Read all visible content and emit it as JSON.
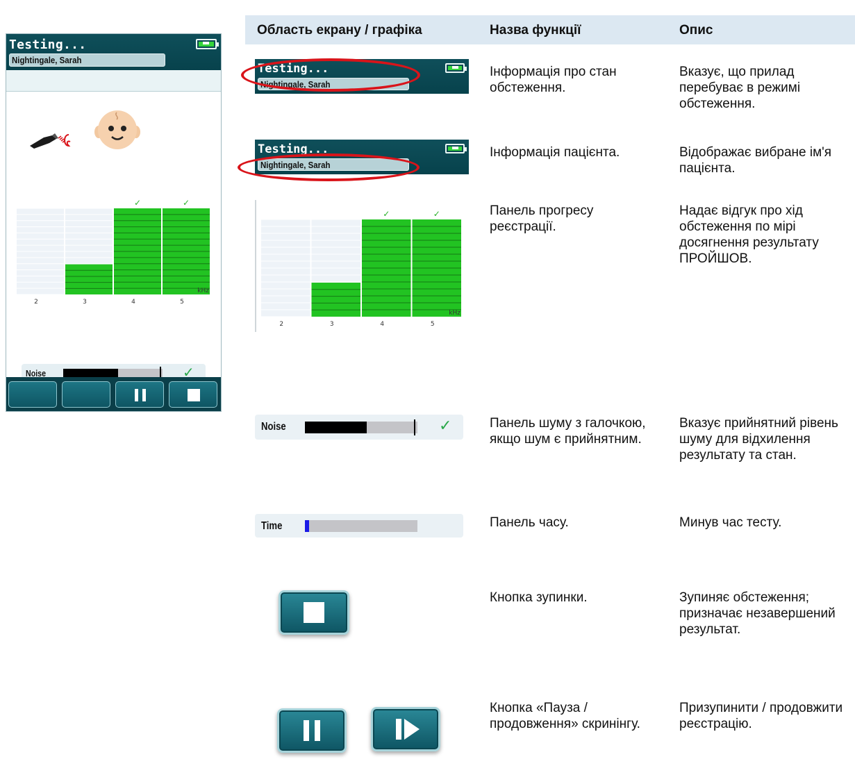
{
  "device": {
    "title": "Testing...",
    "patient": "Nightingale, Sarah",
    "noise_label": "Noise",
    "time_label": "Time",
    "noise_level": 0.55,
    "noise_threshold": 0.97,
    "time_elapsed": 0.04,
    "buttons": [
      "",
      "",
      "pause",
      "stop"
    ]
  },
  "chart_data": {
    "type": "bar",
    "categories": [
      "2",
      "3",
      "4",
      "5"
    ],
    "values": [
      0,
      0.35,
      1.0,
      1.0
    ],
    "passed": [
      false,
      false,
      true,
      true
    ],
    "xlabel": "kHz",
    "ylim": [
      0,
      1
    ]
  },
  "table": {
    "headers": [
      "Область екрану / графіка",
      "Назва функції",
      "Опис"
    ],
    "rows": [
      {
        "name": "Інформація про стан обстеження.",
        "desc": "Вказує, що прилад перебуває в режимі обстеження."
      },
      {
        "name": "Інформація пацієнта.",
        "desc": "Відображає вибране ім'я пацієнта."
      },
      {
        "name": "Панель прогресу реєстрації.",
        "desc": "Надає відгук про хід обстеження по мірі досягнення результату ПРОЙШОВ."
      },
      {
        "name": "Панель шуму з галочкою, якщо шум є прийнятним.",
        "desc": "Вказує прийнятний рівень шуму для відхилення результату та стан."
      },
      {
        "name": "Панель часу.",
        "desc": "Минув час тесту."
      },
      {
        "name": "Кнопка зупинки.",
        "desc": "Зупиняє обстеження; призначає незавершений результат."
      },
      {
        "name": "Кнопка «Пауза / продовження» скринінгу.",
        "desc": "Призупинити / продовжити реєстрацію."
      }
    ]
  },
  "colors": {
    "header_teal": "#07424c",
    "bar_green": "#22c322",
    "check_green": "#2bb32b",
    "highlight_red": "#d9141a",
    "time_blue": "#1a1ae6"
  },
  "icons": [
    "battery-icon",
    "probe-icon",
    "baby-face-icon",
    "check-icon",
    "pause-icon",
    "stop-icon",
    "play-icon"
  ]
}
